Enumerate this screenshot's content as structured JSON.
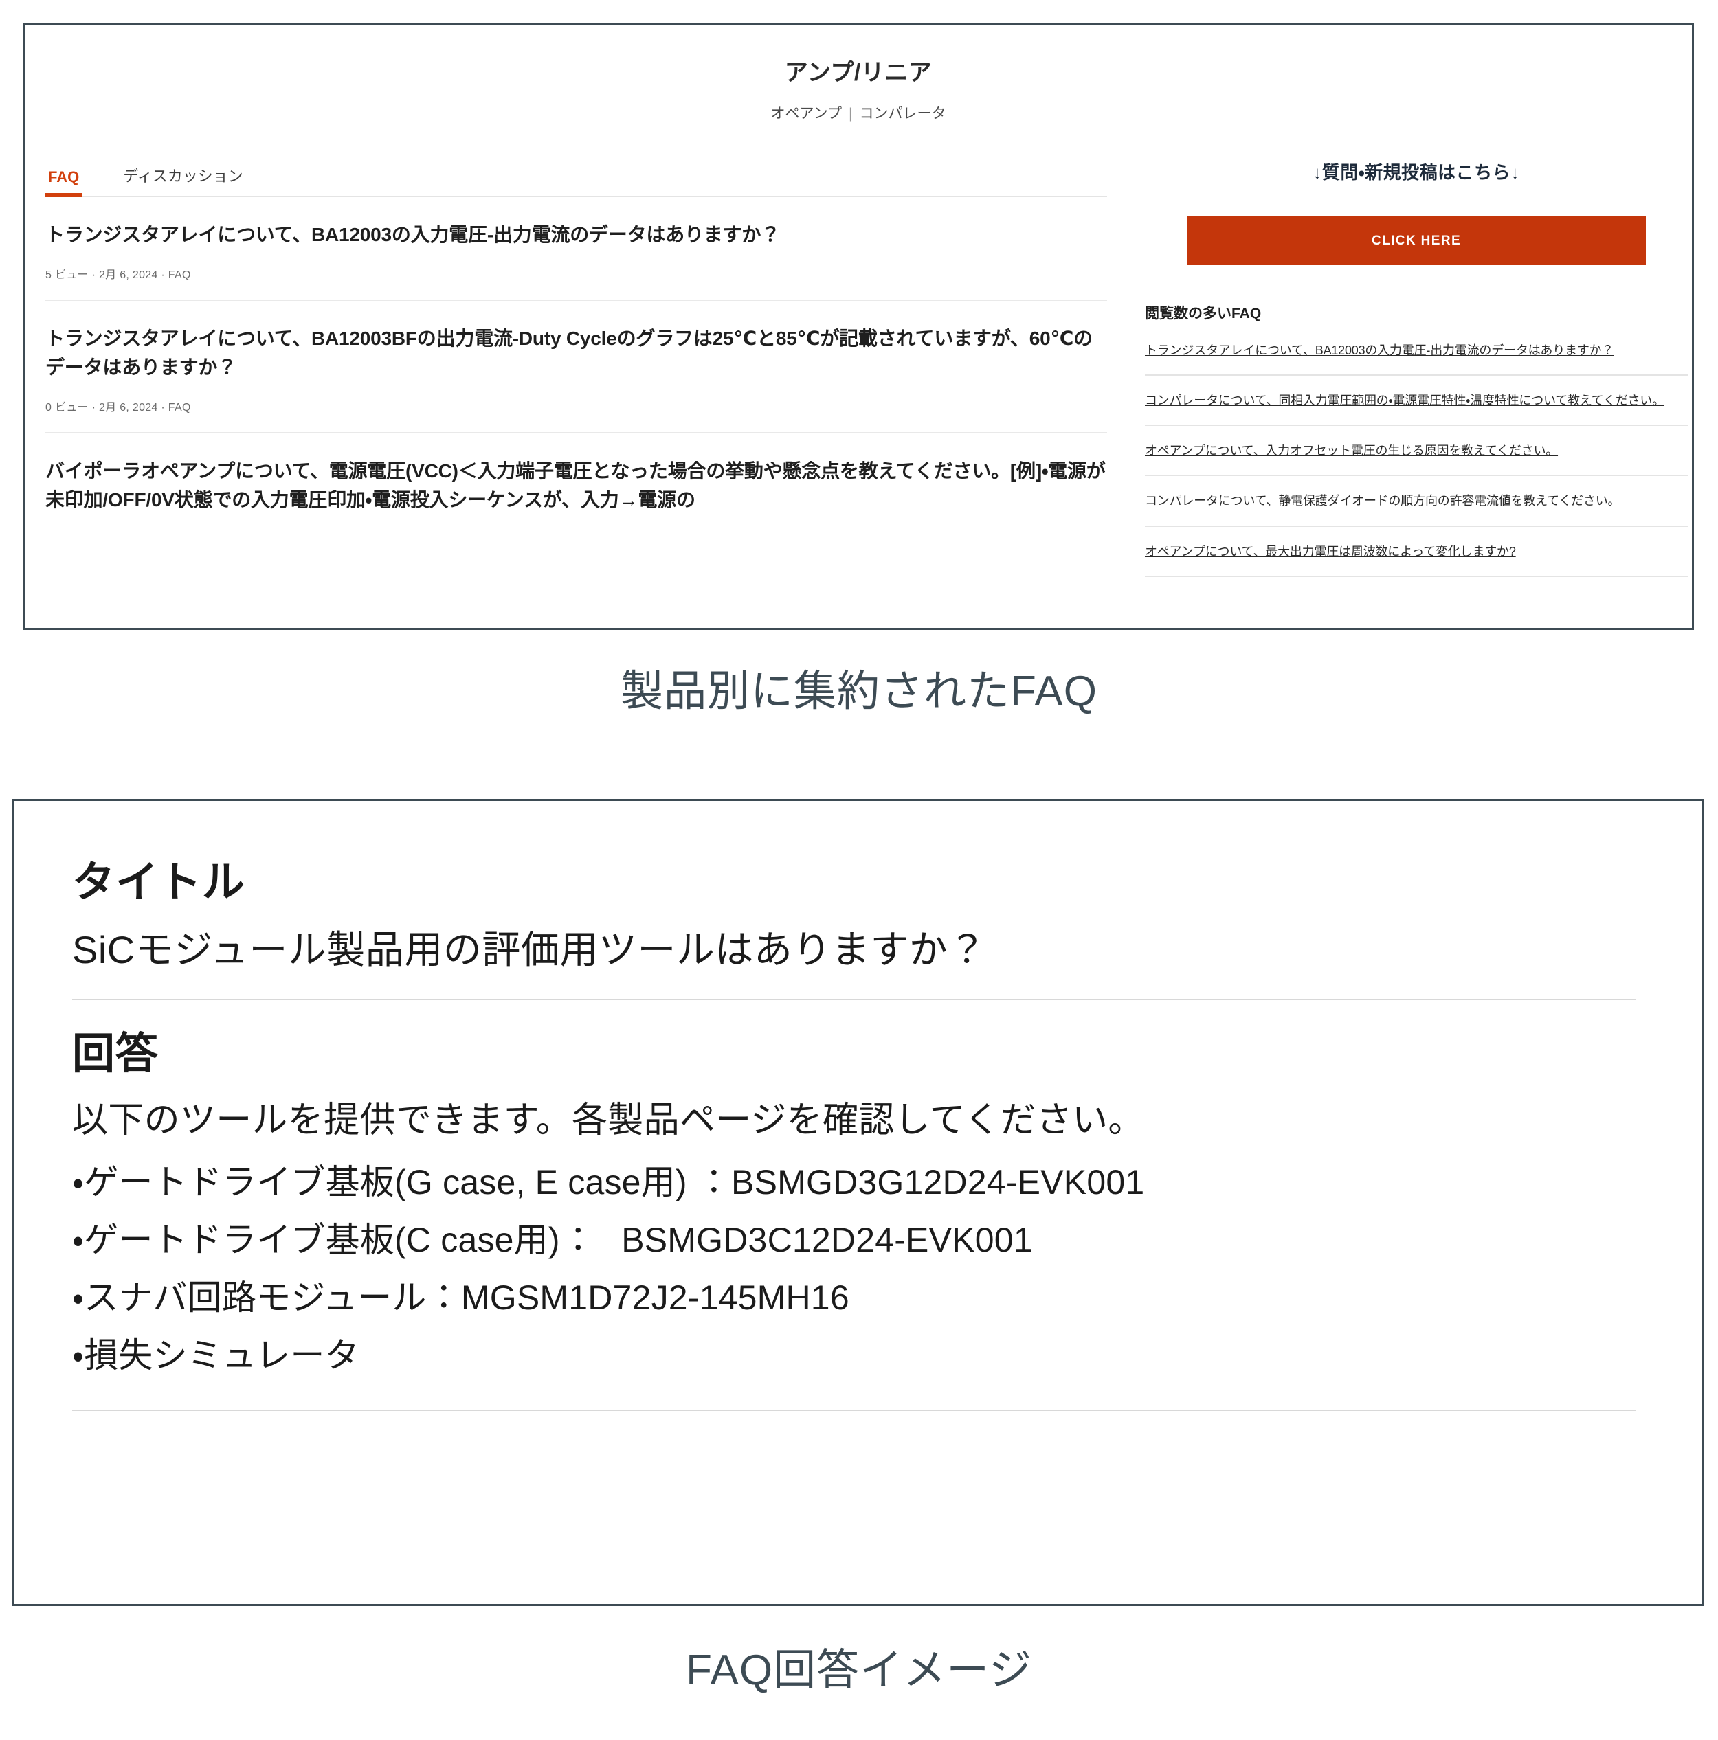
{
  "panel1": {
    "header": {
      "title": "アンプ/リニア",
      "subtitle_left": "オペアンプ",
      "subtitle_sep": "|",
      "subtitle_right": "コンパレータ"
    },
    "tabs": [
      {
        "label": "FAQ",
        "active": true
      },
      {
        "label": "ディスカッション",
        "active": false
      }
    ],
    "faq_items": [
      {
        "question": "トランジスタアレイについて、BA12003の入力電圧-出力電流のデータはありますか？",
        "views": "5 ビュー",
        "date": "2月 6, 2024",
        "category": "FAQ",
        "meta": "5 ビュー  ·  2月 6, 2024  ·  FAQ"
      },
      {
        "question": "トランジスタアレイについて、BA12003BFの出力電流-Duty Cycleのグラフは25℃と85℃が記載されていますが、60℃のデータはありますか？",
        "views": "0 ビュー",
        "date": "2月 6, 2024",
        "category": "FAQ",
        "meta": "0 ビュー  ·  2月 6, 2024  ·  FAQ"
      },
      {
        "question": "バイポーラオペアンプについて、電源電圧(VCC)＜入力端子電圧となった場合の挙動や懸念点を教えてください。[例]・電源が未印加/OFF/0V状態での入力電圧印加・電源投入シーケンスが、入力→電源の",
        "views": "",
        "date": "",
        "category": "",
        "meta": ""
      }
    ],
    "sidebar": {
      "heading": "↓質問・新規投稿はこちら↓",
      "cta_label": "CLICK HERE",
      "cta_color": "#c4360b",
      "popular_heading": "閲覧数の多いFAQ",
      "popular_links": [
        "トランジスタアレイについて、BA12003の入力電圧-出力電流のデータはありますか？",
        "コンパレータについて、同相入力電圧範囲の・電源電圧特性・温度特性について教えてください。",
        "オペアンプについて、入力オフセット電圧の生じる原因を教えてください。",
        "コンパレータについて、静電保護ダイオードの順方向の許容電流値を教えてください。",
        "オペアンプについて、最大出力電圧は周波数によって変化しますか?"
      ]
    }
  },
  "caption1": "製品別に集約されたFAQ",
  "caption2": "FAQ回答イメージ",
  "panel2": {
    "title_heading": "タイトル",
    "question": "SiCモジュール製品用の評価用ツールはありますか？",
    "answer_heading": "回答",
    "answer_intro": "以下のツールを提供できます。各製品ページを確認してください。",
    "answer_items": [
      "・ゲートドライブ基板(G case, E case用) ：BSMGD3G12D24-EVK001",
      "・ゲートドライブ基板(C case用) ：　BSMGD3C12D24-EVK001",
      "・スナバ回路モジュール：MGSM1D72J2-145MH16",
      "・損失シミュレータ"
    ]
  },
  "colors": {
    "accent_orange": "#d2400d",
    "cta_red": "#c4360b",
    "border_slate": "#3d4b54",
    "caption_slate": "#3d4b54"
  }
}
